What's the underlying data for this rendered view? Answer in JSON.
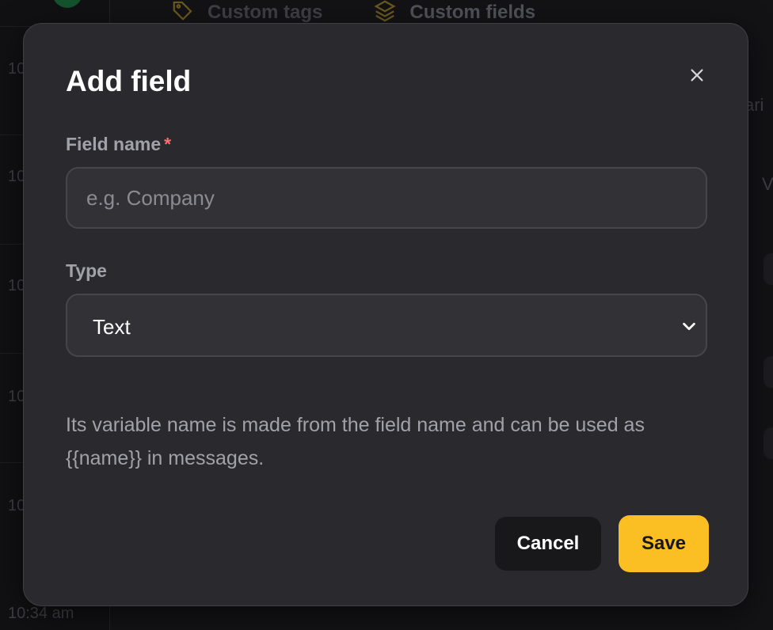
{
  "background": {
    "times": [
      "10",
      "10",
      "10",
      "10",
      "10",
      "10:34 am"
    ],
    "tabs": [
      {
        "label": "Custom tags",
        "icon": "tag-icon"
      },
      {
        "label": "Custom fields",
        "icon": "layers-icon"
      }
    ],
    "right_fragments": [
      "ari",
      "V"
    ]
  },
  "modal": {
    "title": "Add field",
    "close_icon": "close-icon",
    "field_name": {
      "label": "Field name",
      "required_marker": "*",
      "value": "",
      "placeholder": "e.g. Company"
    },
    "type": {
      "label": "Type",
      "selected": "Text",
      "icon": "chevron-down-icon"
    },
    "hint": "Its variable name is made from the field name and can be used as {{name}} in messages.",
    "buttons": {
      "cancel": "Cancel",
      "save": "Save"
    }
  },
  "colors": {
    "accent": "#fbbf24",
    "modal_bg": "#2a2a2e",
    "required": "#f87171"
  }
}
